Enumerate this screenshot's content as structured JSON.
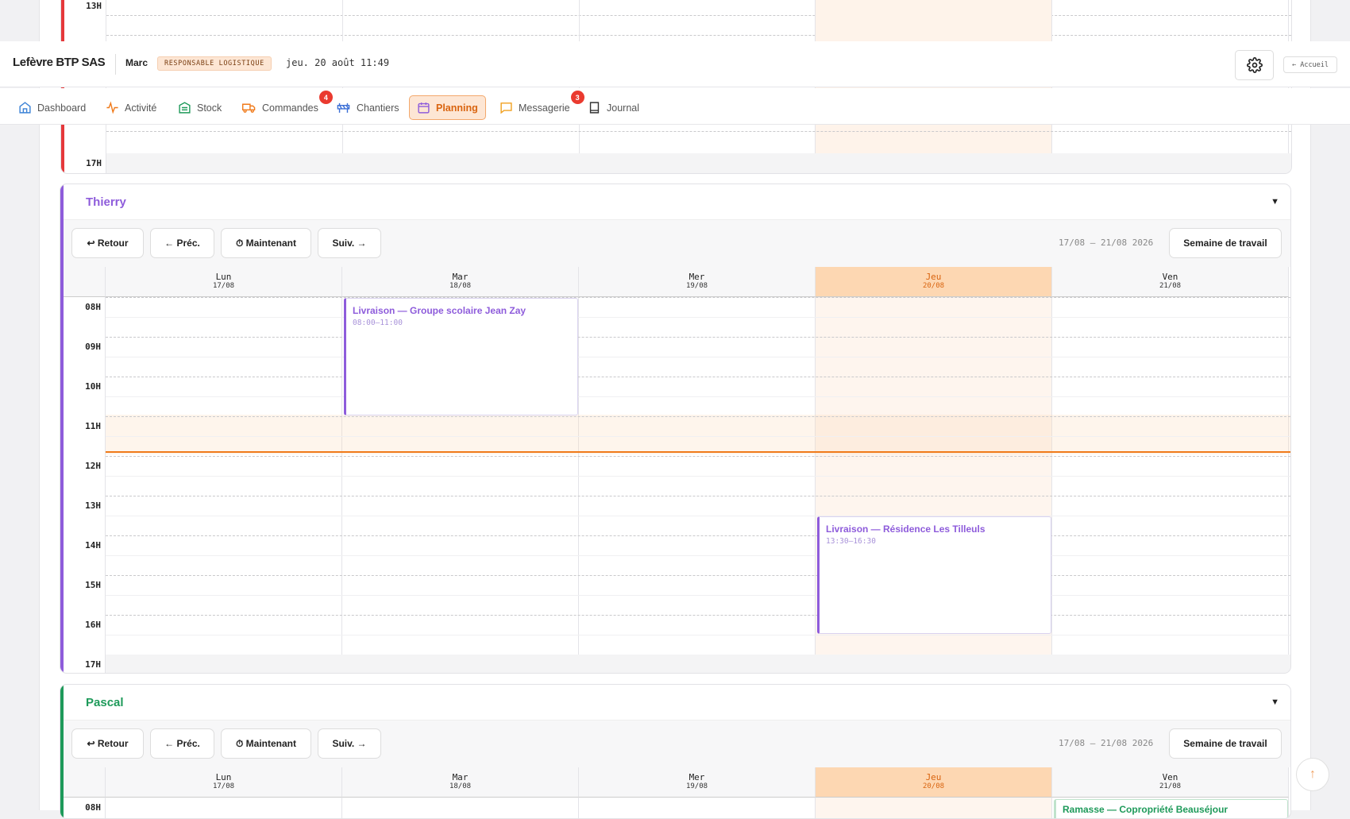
{
  "company": "Lefèvre BTP SAS",
  "user": "Marc",
  "role": "RESPONSABLE LOGISTIQUE",
  "datetime": "jeu. 20 août 11:49",
  "home_label": "← Accueil",
  "nav": [
    {
      "label": "Dashboard",
      "icon": "home-icon"
    },
    {
      "label": "Activité",
      "icon": "activity-icon"
    },
    {
      "label": "Stock",
      "icon": "stock-icon"
    },
    {
      "label": "Commandes",
      "icon": "truck-icon",
      "badge": "4"
    },
    {
      "label": "Chantiers",
      "icon": "barrier-icon"
    },
    {
      "label": "Planning",
      "icon": "calendar-icon",
      "active": true
    },
    {
      "label": "Messagerie",
      "icon": "message-icon",
      "badge": "3"
    },
    {
      "label": "Journal",
      "icon": "book-icon"
    }
  ],
  "toolbar": {
    "back": "↩ Retour",
    "prev": "← Préc.",
    "now": "⏱ Maintenant",
    "next": "Suiv. →",
    "range": "17/08 – 21/08 2026",
    "view": "Semaine de travail"
  },
  "days": [
    {
      "name": "Lun",
      "date": "17/08"
    },
    {
      "name": "Mar",
      "date": "18/08"
    },
    {
      "name": "Mer",
      "date": "19/08"
    },
    {
      "name": "Jeu",
      "date": "20/08"
    },
    {
      "name": "Ven",
      "date": "21/08"
    }
  ],
  "hours": [
    "08H",
    "09H",
    "10H",
    "11H",
    "12H",
    "13H",
    "14H",
    "15H",
    "16H",
    "17H"
  ],
  "top_hours": {
    "a": "13H",
    "b": "17H"
  },
  "colors": {
    "accent": "#f07a1a",
    "thierry": "#8e5cdb",
    "pascal": "#1e9a5a",
    "first": "#e5383b"
  },
  "planners": [
    {
      "name": "Thierry",
      "events": [
        {
          "title": "Livraison — Groupe scolaire Jean Zay",
          "time": "08:00–11:00"
        },
        {
          "title": "Livraison — Résidence Les Tilleuls",
          "time": "13:30–16:30"
        }
      ]
    },
    {
      "name": "Pascal",
      "events": [
        {
          "title": "Ramasse — Copropriété Beauséjour",
          "time": ""
        }
      ]
    }
  ]
}
